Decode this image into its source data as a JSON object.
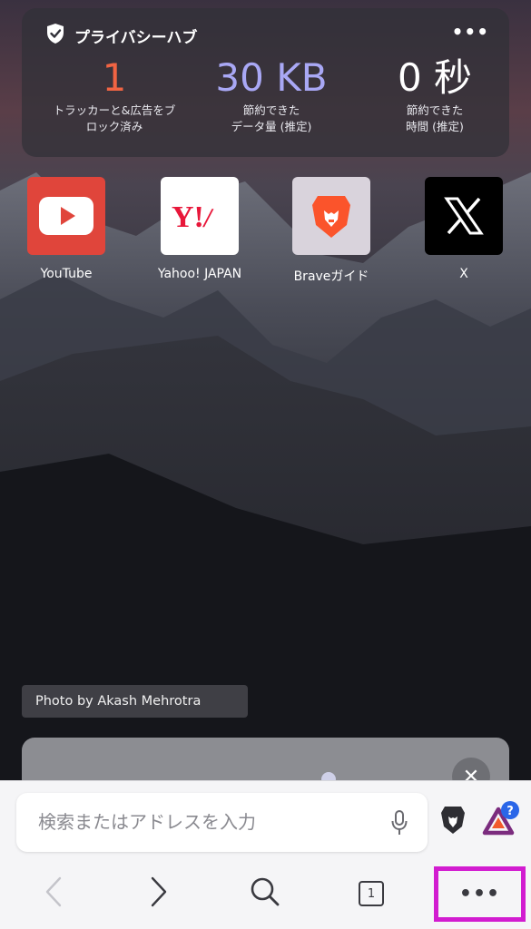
{
  "privacy_hub": {
    "title": "プライバシーハブ",
    "more_icon": "more-dots-icon",
    "stats": [
      {
        "value": "1",
        "label_line1": "トラッカーと&広告をブ",
        "label_line2": "ロック済み",
        "color": "#f16443"
      },
      {
        "value": "30 KB",
        "label_line1": "節約できた",
        "label_line2": "データ量 (推定)",
        "color": "#a9a8f5"
      },
      {
        "value": "0 秒",
        "label_line1": "節約できた",
        "label_line2": "時間 (推定)",
        "color": "#ffffff"
      }
    ]
  },
  "favorites": [
    {
      "name": "YouTube",
      "icon": "youtube-icon"
    },
    {
      "name": "Yahoo! JAPAN",
      "icon": "yahoo-japan-icon"
    },
    {
      "name": "Braveガイド",
      "icon": "brave-lion-icon"
    },
    {
      "name": "X",
      "icon": "x-logo-icon"
    }
  ],
  "photo_credit": "Photo by Akash Mehrotra",
  "urlbar": {
    "placeholder": "検索またはアドレスを入力"
  },
  "toolbar": {
    "tab_count": "1",
    "menu_label": "•••",
    "close_label": "✕"
  },
  "colors": {
    "accent_highlight": "#d21cd0",
    "brave_orange": "#fb542b",
    "youtube_red": "#e0453b"
  }
}
